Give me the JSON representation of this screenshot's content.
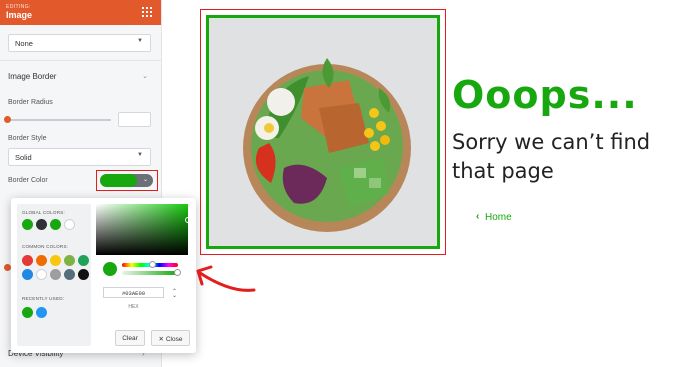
{
  "panel": {
    "header_eyebrow": "EDITING:",
    "header_title": "Image",
    "top_select_value": "None",
    "image_border_title": "Image Border",
    "border_radius_label": "Border Radius",
    "border_style_label": "Border Style",
    "border_style_value": "Solid",
    "border_color_label": "Border Color",
    "border_color_value": "#17a80f",
    "device_visibility_label": "Device Visibility"
  },
  "picker": {
    "global_colors_label": "GLOBAL COLORS:",
    "global_colors": [
      "#17a80f",
      "#2f3135",
      "#17a80f",
      "#ffffff"
    ],
    "common_colors_label": "COMMON COLORS:",
    "common_colors": [
      "#e53935",
      "#ef6c00",
      "#f9c80e",
      "#7cb342",
      "#1fa35a",
      "#1e88e5",
      "#ffffff",
      "#9e9e9e",
      "#546e7a",
      "#111111"
    ],
    "recently_used_label": "RECENTLY USED:",
    "recent_colors": [
      "#17a80f",
      "#2196f3"
    ],
    "hex_value": "#03AE00",
    "hex_label": "HEX",
    "clear_label": "Clear",
    "close_label": "Close",
    "close_icon": "✕"
  },
  "preview": {
    "heading": "Ooops...",
    "subheading": "Sorry we can’t find that page",
    "home_link": "Home",
    "accent_color": "#17a80f"
  }
}
